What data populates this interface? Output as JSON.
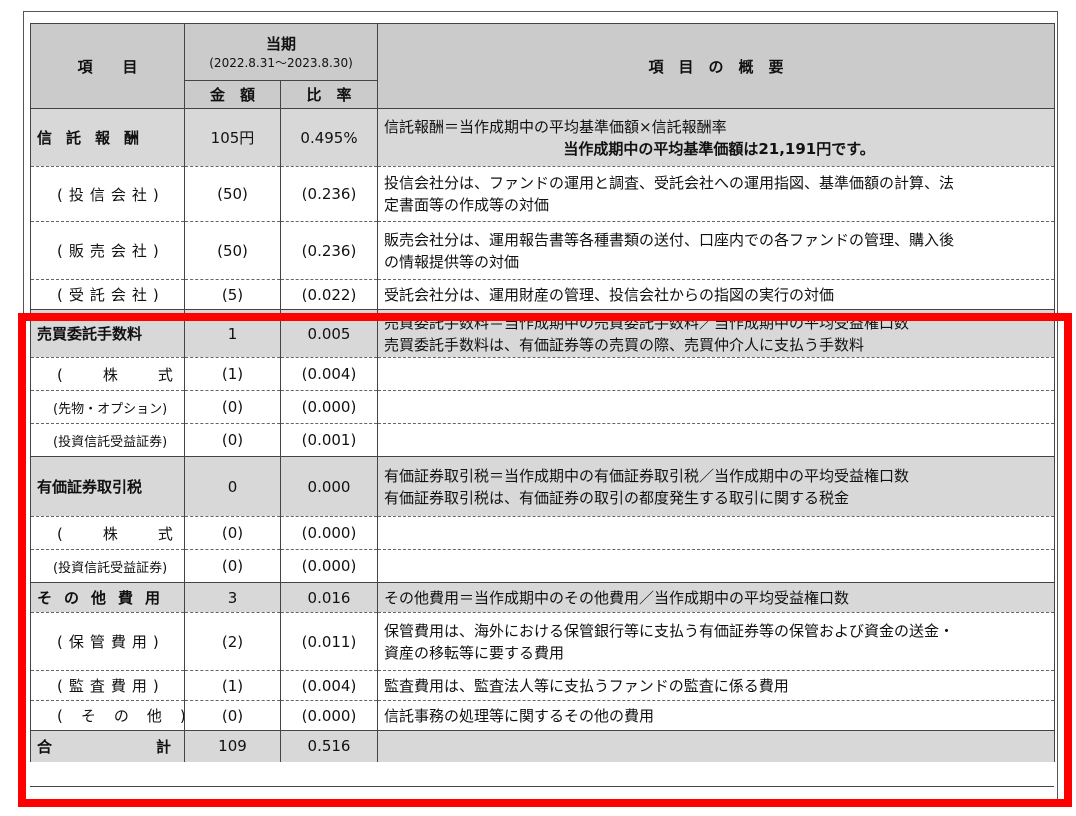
{
  "header": {
    "col_item": "項　　目",
    "period_title": "当期",
    "period_range": "(2022.8.31～2023.8.30)",
    "col_amount": "金　額",
    "col_ratio": "比　率",
    "col_summary": "項　目　の　概　要"
  },
  "rows": [
    {
      "label": "信託報酬",
      "amount": "105円",
      "ratio": "0.495%",
      "desc1": "信託報酬＝当作成期中の平均基準価額×信託報酬率",
      "desc2": "当作成期中の平均基準価額は21,191円です。"
    },
    {
      "label": "(投信会社)",
      "amount": "(50)",
      "ratio": "(0.236)",
      "desc1": "投信会社分は、ファンドの運用と調査、受託会社への運用指図、基準価額の計算、法",
      "desc2": "定書面等の作成等の対価"
    },
    {
      "label": "(販売会社)",
      "amount": "(50)",
      "ratio": "(0.236)",
      "desc1": "販売会社分は、運用報告書等各種書類の送付、口座内での各ファンドの管理、購入後",
      "desc2": "の情報提供等の対価"
    },
    {
      "label": "(受託会社)",
      "amount": "(5)",
      "ratio": "(0.022)",
      "desc1": "受託会社分は、運用財産の管理、投信会社からの指図の実行の対価"
    },
    {
      "label": "売買委託手数料",
      "amount": "1",
      "ratio": "0.005",
      "desc1": "売買委託手数料＝当作成期中の売買委託手数料／当作成期中の平均受益権口数",
      "desc2": "売買委託手数料は、有価証券等の売買の際、売買仲介人に支払う手数料"
    },
    {
      "label": "(株式)",
      "amount": "(1)",
      "ratio": "(0.004)"
    },
    {
      "label": "(先物・オプション)",
      "amount": "(0)",
      "ratio": "(0.000)"
    },
    {
      "label": "(投資信託受益証券)",
      "amount": "(0)",
      "ratio": "(0.001)"
    },
    {
      "label": "有価証券取引税",
      "amount": "0",
      "ratio": "0.000",
      "desc1": "有価証券取引税＝当作成期中の有価証券取引税／当作成期中の平均受益権口数",
      "desc2": "有価証券取引税は、有価証券の取引の都度発生する取引に関する税金"
    },
    {
      "label": "(株式)",
      "amount": "(0)",
      "ratio": "(0.000)"
    },
    {
      "label": "(投資信託受益証券)",
      "amount": "(0)",
      "ratio": "(0.000)"
    },
    {
      "label": "その他費用",
      "amount": "3",
      "ratio": "0.016",
      "desc1": "その他費用＝当作成期中のその他費用／当作成期中の平均受益権口数"
    },
    {
      "label": "(保管費用)",
      "amount": "(2)",
      "ratio": "(0.011)",
      "desc1": "保管費用は、海外における保管銀行等に支払う有価証券等の保管および資金の送金・",
      "desc2": "資産の移転等に要する費用"
    },
    {
      "label": "(監査費用)",
      "amount": "(1)",
      "ratio": "(0.004)",
      "desc1": "監査費用は、監査法人等に支払うファンドの監査に係る費用"
    },
    {
      "label": "(その他)",
      "amount": "(0)",
      "ratio": "(0.000)",
      "desc1": "信託事務の処理等に関するその他の費用"
    },
    {
      "label": "合計",
      "amount": "109",
      "ratio": "0.516"
    }
  ],
  "highlight_color": "#ff0000"
}
